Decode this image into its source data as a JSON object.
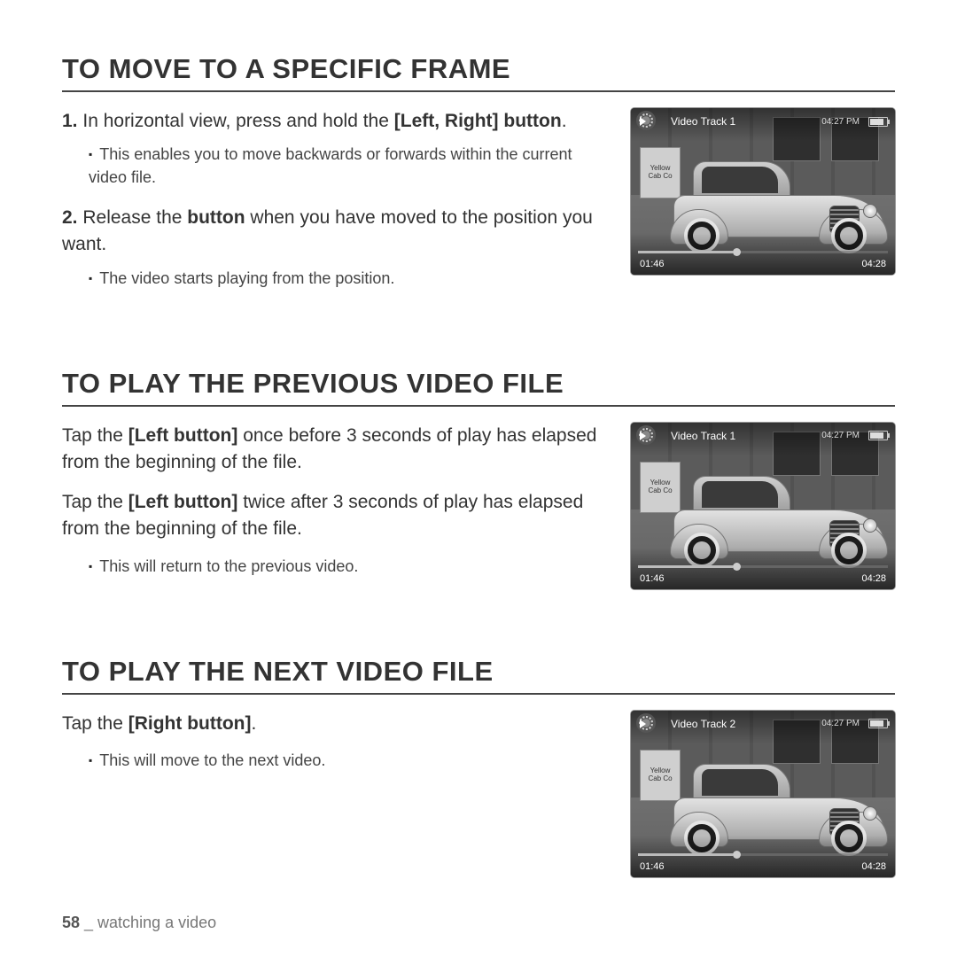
{
  "sections": {
    "s1": {
      "heading": "TO MOVE TO A SPECIFIC FRAME",
      "step1_num": "1.",
      "step1_a": "In horizontal view, press and hold the ",
      "step1_bold": "[Left, Right] button",
      "step1_b": ".",
      "step1_bullet": "This enables you to move backwards or forwards within the current video file.",
      "step2_num": "2.",
      "step2_a": "Release the ",
      "step2_bold": "button",
      "step2_b": " when you have moved to the position you want.",
      "step2_bullet": "The video starts playing from the position."
    },
    "s2": {
      "heading": "TO PLAY THE PREVIOUS VIDEO FILE",
      "p1_a": "Tap the ",
      "p1_bold": "[Left button]",
      "p1_b": " once before 3 seconds of play has elapsed from the beginning of the file.",
      "p2_a": "Tap the ",
      "p2_bold": "[Left button]",
      "p2_b": " twice after 3 seconds of play has elapsed from the beginning of the file.",
      "bullet": "This will return to the previous video."
    },
    "s3": {
      "heading": "TO PLAY THE NEXT VIDEO FILE",
      "p1_a": "Tap the ",
      "p1_bold": "[Right button]",
      "p1_b": ".",
      "bullet": "This will move to the next video."
    }
  },
  "device": {
    "track1": "Video Track 1",
    "track2": "Video Track 2",
    "clock": "04:27 PM",
    "elapsed": "01:46",
    "total": "04:28",
    "sign_l1": "Yellow",
    "sign_l2": "Cab Co"
  },
  "footer": {
    "page": "58",
    "sep": " _ ",
    "chapter": "watching a video"
  }
}
